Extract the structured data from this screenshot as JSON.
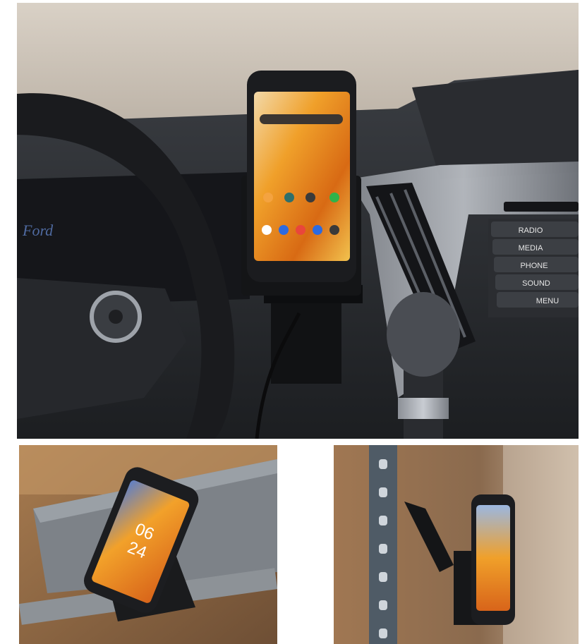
{
  "photos": {
    "dashboard": {
      "dash_buttons": [
        "RADIO",
        "MEDIA",
        "PHONE",
        "SOUND",
        "MENU"
      ],
      "phone_clock": "",
      "brand_badge": "Ford"
    },
    "cart": {
      "phone_clock_hour": "06",
      "phone_clock_min": "24"
    },
    "shelf": {}
  }
}
